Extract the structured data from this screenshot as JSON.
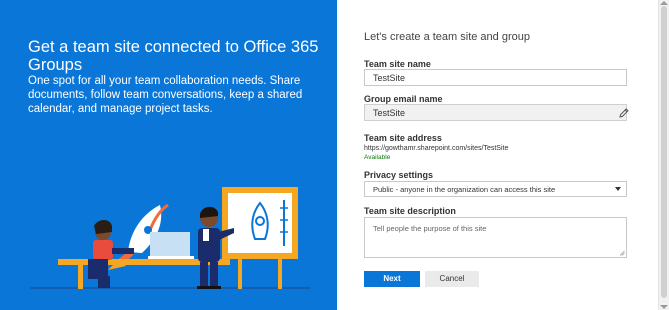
{
  "hero": {
    "title": "Get a team site connected to Office 365 Groups",
    "description": "One spot for all your team collaboration needs. Share documents, follow team conversations, keep a shared calendar, and manage project tasks."
  },
  "form": {
    "subtitle": "Let's create a team site and group",
    "site_name": {
      "label": "Team site name",
      "value": "TestSite"
    },
    "group_email": {
      "label": "Group email name",
      "value": "TestSite"
    },
    "site_address": {
      "label": "Team site address",
      "url": "https://gowthamr.sharepoint.com/sites/TestSite",
      "status": "Available"
    },
    "privacy": {
      "label": "Privacy settings",
      "selected": "Public - anyone in the organization can access this site"
    },
    "description": {
      "label": "Team site description",
      "placeholder": "Tell people the purpose of this site"
    },
    "buttons": {
      "next": "Next",
      "cancel": "Cancel"
    }
  },
  "colors": {
    "brand_blue": "#0a76d8",
    "illustration_orange": "#f5a623",
    "available_green": "#107c10"
  },
  "icons": [
    "edit-pencil-icon",
    "dropdown-caret-icon",
    "rocket-icon",
    "resize-grip-icon"
  ]
}
